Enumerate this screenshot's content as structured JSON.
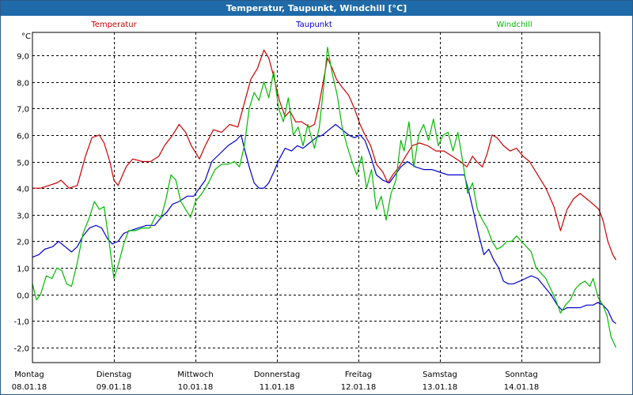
{
  "window": {
    "title": "Temperatur, Taupunkt, Windchill [°C]"
  },
  "chart_data": {
    "type": "line",
    "title": "Temperatur, Taupunkt, Windchill [°C]",
    "ylabel": "°C",
    "ylim": [
      -2.5,
      10.0
    ],
    "yticks": [
      9.0,
      8.0,
      7.0,
      6.0,
      5.0,
      4.0,
      3.0,
      2.0,
      1.0,
      0.0,
      -1.0,
      -2.0
    ],
    "ytick_labels": [
      "9,0",
      "8,0",
      "7,0",
      "6,0",
      "5,0",
      "4,0",
      "3,0",
      "2,0",
      "1,0",
      "0,0",
      "-1,0",
      "-2,0"
    ],
    "xlim": [
      0,
      7.0
    ],
    "days": [
      {
        "weekday": "Montag",
        "date": "08.01.18"
      },
      {
        "weekday": "Dienstag",
        "date": "09.01.18"
      },
      {
        "weekday": "Mittwoch",
        "date": "10.01.18"
      },
      {
        "weekday": "Donnerstag",
        "date": "11.01.18"
      },
      {
        "weekday": "Freitag",
        "date": "12.01.18"
      },
      {
        "weekday": "Samstag",
        "date": "13.01.18"
      },
      {
        "weekday": "Sonntag",
        "date": "14.01.18"
      }
    ],
    "grid": true,
    "series": [
      {
        "name": "Temperatur",
        "color": "#cc0000",
        "points": [
          [
            0.0,
            4.0
          ],
          [
            0.1,
            4.0
          ],
          [
            0.2,
            4.1
          ],
          [
            0.3,
            4.2
          ],
          [
            0.35,
            4.3
          ],
          [
            0.45,
            4.0
          ],
          [
            0.55,
            4.1
          ],
          [
            0.65,
            5.2
          ],
          [
            0.73,
            5.9
          ],
          [
            0.82,
            6.0
          ],
          [
            0.88,
            5.7
          ],
          [
            0.95,
            5.0
          ],
          [
            1.0,
            4.3
          ],
          [
            1.05,
            4.1
          ],
          [
            1.15,
            4.8
          ],
          [
            1.23,
            5.1
          ],
          [
            1.35,
            5.0
          ],
          [
            1.45,
            5.0
          ],
          [
            1.55,
            5.2
          ],
          [
            1.62,
            5.6
          ],
          [
            1.72,
            6.0
          ],
          [
            1.8,
            6.4
          ],
          [
            1.88,
            6.1
          ],
          [
            1.95,
            5.6
          ],
          [
            2.05,
            5.1
          ],
          [
            2.12,
            5.6
          ],
          [
            2.22,
            6.2
          ],
          [
            2.32,
            6.1
          ],
          [
            2.42,
            6.4
          ],
          [
            2.52,
            6.3
          ],
          [
            2.6,
            7.2
          ],
          [
            2.68,
            8.1
          ],
          [
            2.76,
            8.5
          ],
          [
            2.84,
            9.2
          ],
          [
            2.9,
            8.9
          ],
          [
            2.96,
            8.2
          ],
          [
            3.03,
            7.3
          ],
          [
            3.1,
            6.7
          ],
          [
            3.16,
            6.9
          ],
          [
            3.23,
            6.5
          ],
          [
            3.3,
            6.5
          ],
          [
            3.4,
            6.3
          ],
          [
            3.46,
            6.4
          ],
          [
            3.52,
            7.2
          ],
          [
            3.58,
            8.2
          ],
          [
            3.62,
            8.9
          ],
          [
            3.68,
            8.5
          ],
          [
            3.73,
            8.1
          ],
          [
            3.8,
            7.8
          ],
          [
            3.88,
            7.5
          ],
          [
            3.95,
            7.0
          ],
          [
            4.02,
            6.4
          ],
          [
            4.08,
            6.0
          ],
          [
            4.15,
            5.6
          ],
          [
            4.22,
            4.9
          ],
          [
            4.3,
            4.6
          ],
          [
            4.36,
            4.2
          ],
          [
            4.42,
            4.5
          ],
          [
            4.5,
            4.8
          ],
          [
            4.58,
            5.2
          ],
          [
            4.66,
            5.6
          ],
          [
            4.75,
            5.7
          ],
          [
            4.85,
            5.6
          ],
          [
            4.95,
            5.4
          ],
          [
            5.05,
            5.4
          ],
          [
            5.15,
            5.2
          ],
          [
            5.25,
            5.0
          ],
          [
            5.33,
            4.8
          ],
          [
            5.4,
            5.2
          ],
          [
            5.45,
            5.0
          ],
          [
            5.52,
            4.8
          ],
          [
            5.58,
            5.3
          ],
          [
            5.64,
            6.0
          ],
          [
            5.7,
            5.9
          ],
          [
            5.78,
            5.6
          ],
          [
            5.86,
            5.4
          ],
          [
            5.94,
            5.5
          ],
          [
            6.02,
            5.2
          ],
          [
            6.1,
            5.0
          ],
          [
            6.2,
            4.5
          ],
          [
            6.3,
            4.0
          ],
          [
            6.4,
            3.3
          ],
          [
            6.48,
            2.4
          ],
          [
            6.56,
            3.2
          ],
          [
            6.64,
            3.6
          ],
          [
            6.72,
            3.8
          ],
          [
            6.8,
            3.6
          ],
          [
            6.88,
            3.4
          ],
          [
            6.95,
            3.2
          ],
          [
            7.0,
            2.8
          ],
          [
            7.06,
            2.0
          ],
          [
            7.12,
            1.5
          ],
          [
            7.16,
            1.3
          ]
        ]
      },
      {
        "name": "Taupunkt",
        "color": "#0000cc",
        "points": [
          [
            0.0,
            1.4
          ],
          [
            0.08,
            1.5
          ],
          [
            0.15,
            1.7
          ],
          [
            0.25,
            1.8
          ],
          [
            0.32,
            2.0
          ],
          [
            0.4,
            1.8
          ],
          [
            0.48,
            1.6
          ],
          [
            0.55,
            1.8
          ],
          [
            0.62,
            2.2
          ],
          [
            0.7,
            2.5
          ],
          [
            0.78,
            2.6
          ],
          [
            0.85,
            2.5
          ],
          [
            0.92,
            2.1
          ],
          [
            0.98,
            1.9
          ],
          [
            1.05,
            2.0
          ],
          [
            1.12,
            2.3
          ],
          [
            1.2,
            2.4
          ],
          [
            1.3,
            2.5
          ],
          [
            1.4,
            2.6
          ],
          [
            1.5,
            2.6
          ],
          [
            1.58,
            2.9
          ],
          [
            1.65,
            3.1
          ],
          [
            1.72,
            3.4
          ],
          [
            1.8,
            3.5
          ],
          [
            1.9,
            3.7
          ],
          [
            1.98,
            3.7
          ],
          [
            2.05,
            4.0
          ],
          [
            2.12,
            4.3
          ],
          [
            2.2,
            5.0
          ],
          [
            2.3,
            5.3
          ],
          [
            2.4,
            5.6
          ],
          [
            2.5,
            5.8
          ],
          [
            2.56,
            6.0
          ],
          [
            2.6,
            5.5
          ],
          [
            2.66,
            4.8
          ],
          [
            2.72,
            4.2
          ],
          [
            2.78,
            4.0
          ],
          [
            2.84,
            4.0
          ],
          [
            2.9,
            4.2
          ],
          [
            2.96,
            4.6
          ],
          [
            3.03,
            5.1
          ],
          [
            3.1,
            5.5
          ],
          [
            3.18,
            5.4
          ],
          [
            3.25,
            5.6
          ],
          [
            3.32,
            5.5
          ],
          [
            3.4,
            5.7
          ],
          [
            3.48,
            5.9
          ],
          [
            3.56,
            6.0
          ],
          [
            3.64,
            6.2
          ],
          [
            3.72,
            6.4
          ],
          [
            3.8,
            6.2
          ],
          [
            3.88,
            6.0
          ],
          [
            3.95,
            5.9
          ],
          [
            4.02,
            6.0
          ],
          [
            4.08,
            5.8
          ],
          [
            4.15,
            5.2
          ],
          [
            4.22,
            4.5
          ],
          [
            4.3,
            4.3
          ],
          [
            4.38,
            4.2
          ],
          [
            4.45,
            4.5
          ],
          [
            4.52,
            4.8
          ],
          [
            4.6,
            5.0
          ],
          [
            4.7,
            4.8
          ],
          [
            4.8,
            4.7
          ],
          [
            4.9,
            4.7
          ],
          [
            5.0,
            4.6
          ],
          [
            5.1,
            4.5
          ],
          [
            5.2,
            4.5
          ],
          [
            5.3,
            4.5
          ],
          [
            5.36,
            3.8
          ],
          [
            5.42,
            3.0
          ],
          [
            5.48,
            2.2
          ],
          [
            5.54,
            1.5
          ],
          [
            5.6,
            1.7
          ],
          [
            5.66,
            1.3
          ],
          [
            5.72,
            1.0
          ],
          [
            5.78,
            0.5
          ],
          [
            5.84,
            0.4
          ],
          [
            5.9,
            0.4
          ],
          [
            5.98,
            0.5
          ],
          [
            6.05,
            0.6
          ],
          [
            6.12,
            0.7
          ],
          [
            6.2,
            0.6
          ],
          [
            6.28,
            0.3
          ],
          [
            6.36,
            0.0
          ],
          [
            6.44,
            -0.4
          ],
          [
            6.5,
            -0.6
          ],
          [
            6.56,
            -0.5
          ],
          [
            6.64,
            -0.5
          ],
          [
            6.72,
            -0.5
          ],
          [
            6.8,
            -0.4
          ],
          [
            6.88,
            -0.4
          ],
          [
            6.94,
            -0.3
          ],
          [
            7.0,
            -0.4
          ],
          [
            7.06,
            -0.6
          ],
          [
            7.12,
            -1.0
          ],
          [
            7.16,
            -1.1
          ]
        ]
      },
      {
        "name": "Windchill",
        "color": "#00bb00",
        "points": [
          [
            0.0,
            0.4
          ],
          [
            0.05,
            -0.2
          ],
          [
            0.1,
            0.0
          ],
          [
            0.17,
            0.7
          ],
          [
            0.24,
            0.6
          ],
          [
            0.3,
            1.0
          ],
          [
            0.36,
            0.9
          ],
          [
            0.42,
            0.4
          ],
          [
            0.48,
            0.3
          ],
          [
            0.55,
            1.2
          ],
          [
            0.62,
            2.3
          ],
          [
            0.7,
            2.9
          ],
          [
            0.76,
            3.5
          ],
          [
            0.82,
            3.2
          ],
          [
            0.88,
            3.3
          ],
          [
            0.94,
            2.0
          ],
          [
            1.0,
            0.6
          ],
          [
            1.06,
            1.2
          ],
          [
            1.12,
            1.9
          ],
          [
            1.18,
            2.4
          ],
          [
            1.26,
            2.4
          ],
          [
            1.35,
            2.5
          ],
          [
            1.44,
            2.5
          ],
          [
            1.52,
            3.0
          ],
          [
            1.58,
            2.9
          ],
          [
            1.64,
            3.6
          ],
          [
            1.7,
            4.5
          ],
          [
            1.76,
            4.3
          ],
          [
            1.82,
            3.5
          ],
          [
            1.88,
            3.2
          ],
          [
            1.94,
            2.9
          ],
          [
            2.0,
            3.5
          ],
          [
            2.08,
            3.8
          ],
          [
            2.16,
            4.2
          ],
          [
            2.24,
            4.7
          ],
          [
            2.32,
            4.9
          ],
          [
            2.4,
            4.9
          ],
          [
            2.48,
            5.0
          ],
          [
            2.54,
            4.8
          ],
          [
            2.6,
            5.6
          ],
          [
            2.66,
            7.0
          ],
          [
            2.72,
            7.6
          ],
          [
            2.78,
            7.3
          ],
          [
            2.84,
            8.0
          ],
          [
            2.9,
            7.4
          ],
          [
            2.96,
            8.4
          ],
          [
            3.02,
            7.0
          ],
          [
            3.08,
            6.5
          ],
          [
            3.14,
            7.4
          ],
          [
            3.2,
            6.0
          ],
          [
            3.26,
            6.3
          ],
          [
            3.32,
            5.6
          ],
          [
            3.38,
            6.4
          ],
          [
            3.46,
            5.5
          ],
          [
            3.52,
            6.3
          ],
          [
            3.58,
            8.0
          ],
          [
            3.62,
            9.3
          ],
          [
            3.68,
            8.3
          ],
          [
            3.74,
            7.5
          ],
          [
            3.8,
            6.3
          ],
          [
            3.86,
            5.6
          ],
          [
            3.92,
            5.0
          ],
          [
            3.98,
            4.5
          ],
          [
            4.04,
            5.2
          ],
          [
            4.1,
            4.0
          ],
          [
            4.16,
            4.7
          ],
          [
            4.22,
            3.2
          ],
          [
            4.28,
            3.7
          ],
          [
            4.34,
            2.8
          ],
          [
            4.4,
            3.8
          ],
          [
            4.46,
            4.3
          ],
          [
            4.52,
            5.8
          ],
          [
            4.56,
            5.4
          ],
          [
            4.62,
            6.5
          ],
          [
            4.68,
            4.8
          ],
          [
            4.74,
            6.0
          ],
          [
            4.8,
            6.4
          ],
          [
            4.86,
            5.8
          ],
          [
            4.92,
            6.6
          ],
          [
            4.98,
            5.6
          ],
          [
            5.04,
            6.0
          ],
          [
            5.1,
            6.1
          ],
          [
            5.16,
            5.4
          ],
          [
            5.22,
            6.1
          ],
          [
            5.28,
            5.0
          ],
          [
            5.34,
            3.8
          ],
          [
            5.4,
            4.2
          ],
          [
            5.46,
            3.2
          ],
          [
            5.52,
            2.8
          ],
          [
            5.58,
            2.5
          ],
          [
            5.64,
            2.0
          ],
          [
            5.7,
            1.7
          ],
          [
            5.76,
            1.8
          ],
          [
            5.82,
            2.0
          ],
          [
            5.88,
            2.0
          ],
          [
            5.94,
            2.2
          ],
          [
            6.0,
            2.0
          ],
          [
            6.06,
            1.8
          ],
          [
            6.12,
            1.6
          ],
          [
            6.18,
            1.0
          ],
          [
            6.24,
            0.8
          ],
          [
            6.3,
            0.6
          ],
          [
            6.36,
            0.2
          ],
          [
            6.42,
            -0.2
          ],
          [
            6.48,
            -0.7
          ],
          [
            6.54,
            -0.4
          ],
          [
            6.6,
            -0.2
          ],
          [
            6.66,
            0.2
          ],
          [
            6.72,
            0.4
          ],
          [
            6.78,
            0.5
          ],
          [
            6.84,
            0.3
          ],
          [
            6.88,
            0.6
          ],
          [
            6.94,
            -0.1
          ],
          [
            7.0,
            -0.4
          ],
          [
            7.05,
            -0.8
          ],
          [
            7.1,
            -1.6
          ],
          [
            7.16,
            -2.0
          ]
        ]
      }
    ]
  }
}
